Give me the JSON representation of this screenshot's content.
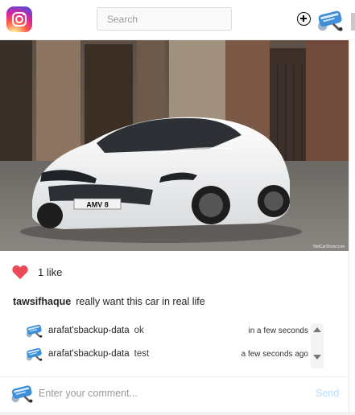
{
  "header": {
    "logo_icon": "instagram-icon",
    "search_placeholder": "Search",
    "new_post_icon": "plus-circle-icon",
    "profile_avatar": "backup-avatar"
  },
  "post": {
    "image_alt": "White sports car",
    "plate_text": "AMV 8",
    "watermark": "NetCarShow.com",
    "likes_label": "1 like",
    "caption_user": "tawsifhaque",
    "caption_text": "really want this car in real life"
  },
  "comments": [
    {
      "user": "arafat'sbackup-data",
      "text": "ok",
      "time": "in a few seconds"
    },
    {
      "user": "arafat'sbackup-data",
      "text": "test",
      "time": "a few seconds ago"
    }
  ],
  "comment_box": {
    "placeholder": "Enter your comment...",
    "send_label": "Send"
  },
  "colors": {
    "heart": "#ed4956",
    "send_disabled": "#b3dbff",
    "avatar_blue": "#3e8fd8"
  }
}
